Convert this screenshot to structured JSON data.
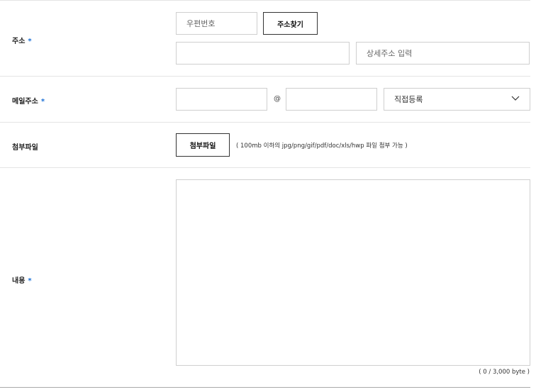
{
  "address": {
    "label": "주소",
    "required_mark": "*",
    "postcode_placeholder": "우편번호",
    "find_button": "주소찾기",
    "address_value": "",
    "detail_placeholder": "상세주소 입력"
  },
  "email": {
    "label": "메일주소",
    "required_mark": "*",
    "local_value": "",
    "at_symbol": "@",
    "domain_value": "",
    "domain_select_selected": "직접등록",
    "chevron_icon": "chevron-down-icon"
  },
  "attachment": {
    "label": "첨부파일",
    "button": "첨부파일",
    "note": "( 100mb 이하의 jpg/png/gif/pdf/doc/xls/hwp 파일 첨부 가능 )"
  },
  "content": {
    "label": "내용",
    "required_mark": "*",
    "value": "",
    "counter": "( 0 / 3,000 byte )"
  },
  "colors": {
    "required_star": "#1a6fd6",
    "border": "#cfcfcf",
    "divider": "#e4e4e4"
  }
}
